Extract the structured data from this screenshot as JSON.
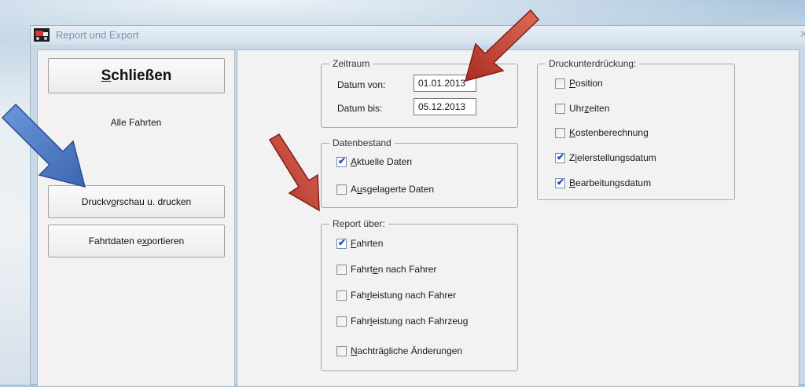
{
  "window": {
    "title": "Report und Export",
    "close_glyph": "✕"
  },
  "left": {
    "close_button": {
      "before": "",
      "mnemonic": "S",
      "after": "chließen"
    },
    "subtitle": "Alle Fahrten",
    "preview_button": {
      "before": "Druckv",
      "mnemonic": "o",
      "after": "rschau u. drucken"
    },
    "export_button": {
      "before": "Fahrtdaten e",
      "mnemonic": "x",
      "after": "portieren"
    }
  },
  "zeitraum": {
    "legend": "Zeitraum",
    "von_label": "Datum von:",
    "von_value": "01.01.2013",
    "bis_label": "Datum bis:",
    "bis_value": "05.12.2013"
  },
  "datenbestand": {
    "legend": "Datenbestand",
    "items": [
      {
        "before": "",
        "mnemonic": "A",
        "after": "ktuelle Daten",
        "checked": true
      },
      {
        "before": "A",
        "mnemonic": "u",
        "after": "sgelagerte Daten",
        "checked": false
      }
    ]
  },
  "report": {
    "legend": "Report über:",
    "items": [
      {
        "before": "",
        "mnemonic": "F",
        "after": "ahrten",
        "checked": true
      },
      {
        "before": "Fahrt",
        "mnemonic": "e",
        "after": "n nach Fahrer",
        "checked": false
      },
      {
        "before": "Fah",
        "mnemonic": "r",
        "after": "leistung nach Fahrer",
        "checked": false
      },
      {
        "before": "Fahr",
        "mnemonic": "l",
        "after": "eistung nach Fahrzeug",
        "checked": false
      },
      {
        "before": "",
        "mnemonic": "N",
        "after": "achträgliche Änderungen",
        "checked": false
      }
    ]
  },
  "druck": {
    "legend": "Druckunterdrückung:",
    "items": [
      {
        "before": "",
        "mnemonic": "P",
        "after": "osition",
        "checked": false
      },
      {
        "before": "Uhr",
        "mnemonic": "z",
        "after": "eiten",
        "checked": false
      },
      {
        "before": "",
        "mnemonic": "K",
        "after": "ostenberechnung",
        "checked": false
      },
      {
        "before": "Z",
        "mnemonic": "i",
        "after": "elerstellungsdatum",
        "checked": true
      },
      {
        "before": "",
        "mnemonic": "B",
        "after": "earbeitungsdatum",
        "checked": true
      }
    ]
  },
  "colors": {
    "red_arrow": "#c0392b",
    "blue_arrow": "#4a78c2"
  }
}
